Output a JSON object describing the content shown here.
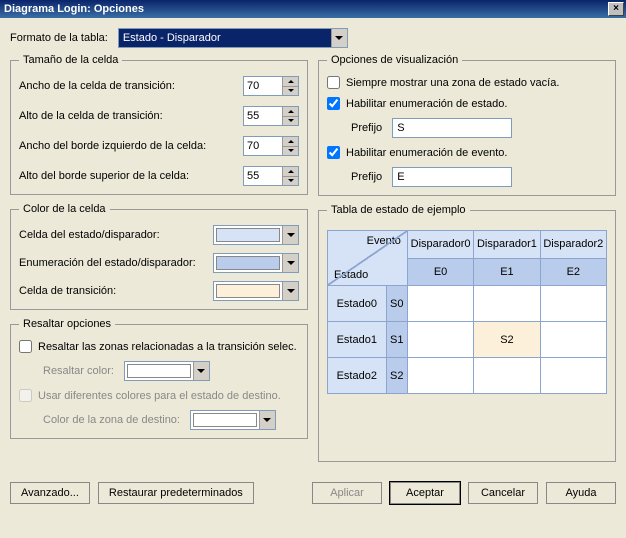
{
  "title": "Diagrama Login: Opciones",
  "tableFormat": {
    "label": "Formato de la tabla:",
    "value": "Estado - Disparador"
  },
  "cellSize": {
    "legend": "Tamaño de la celda",
    "transWidth": {
      "label": "Ancho de la celda de transición:",
      "value": "70"
    },
    "transHeight": {
      "label": "Alto de la celda de transición:",
      "value": "55"
    },
    "leftBorder": {
      "label": "Ancho del borde izquierdo de la celda:",
      "value": "70"
    },
    "topBorder": {
      "label": "Alto del borde superior de la celda:",
      "value": "55"
    }
  },
  "cellColor": {
    "legend": "Color de la celda",
    "stateTrigger": "Celda del estado/disparador:",
    "enum": "Enumeración del estado/disparador:",
    "transition": "Celda de transición:",
    "swatches": {
      "stateTrigger": "#D6E2F5",
      "enum": "#B9CCEB",
      "transition": "#FDF0DA"
    }
  },
  "highlight": {
    "legend": "Resaltar opciones",
    "relAreas": "Resaltar las zonas relacionadas a la transición selec.",
    "colorLabel": "Resaltar color:",
    "diffColors": "Usar diferentes colores para el estado de destino.",
    "destColorLabel": "Color de la zona de destino:"
  },
  "viewOpts": {
    "legend": "Opciones de visualización",
    "alwaysEmpty": "Siempre mostrar una zona de estado vacía.",
    "enableStateEnum": "Habilitar enumeración de estado.",
    "enableEventEnum": "Habilitar enumeración de evento.",
    "prefixLabel": "Prefijo",
    "statePrefix": "S",
    "eventPrefix": "E"
  },
  "sample": {
    "legend": "Tabla de estado de ejemplo",
    "eventLabel": "Evento",
    "stateLabel": "Estado",
    "cols": [
      "Disparador0",
      "Disparador1",
      "Disparador2"
    ],
    "colNums": [
      "E0",
      "E1",
      "E2"
    ],
    "rows": [
      "Estado0",
      "Estado1",
      "Estado2"
    ],
    "rowNums": [
      "S0",
      "S1",
      "S2"
    ],
    "hlCell": "S2"
  },
  "buttons": {
    "advanced": "Avanzado...",
    "restore": "Restaurar predeterminados",
    "apply": "Aplicar",
    "ok": "Aceptar",
    "cancel": "Cancelar",
    "help": "Ayuda"
  }
}
